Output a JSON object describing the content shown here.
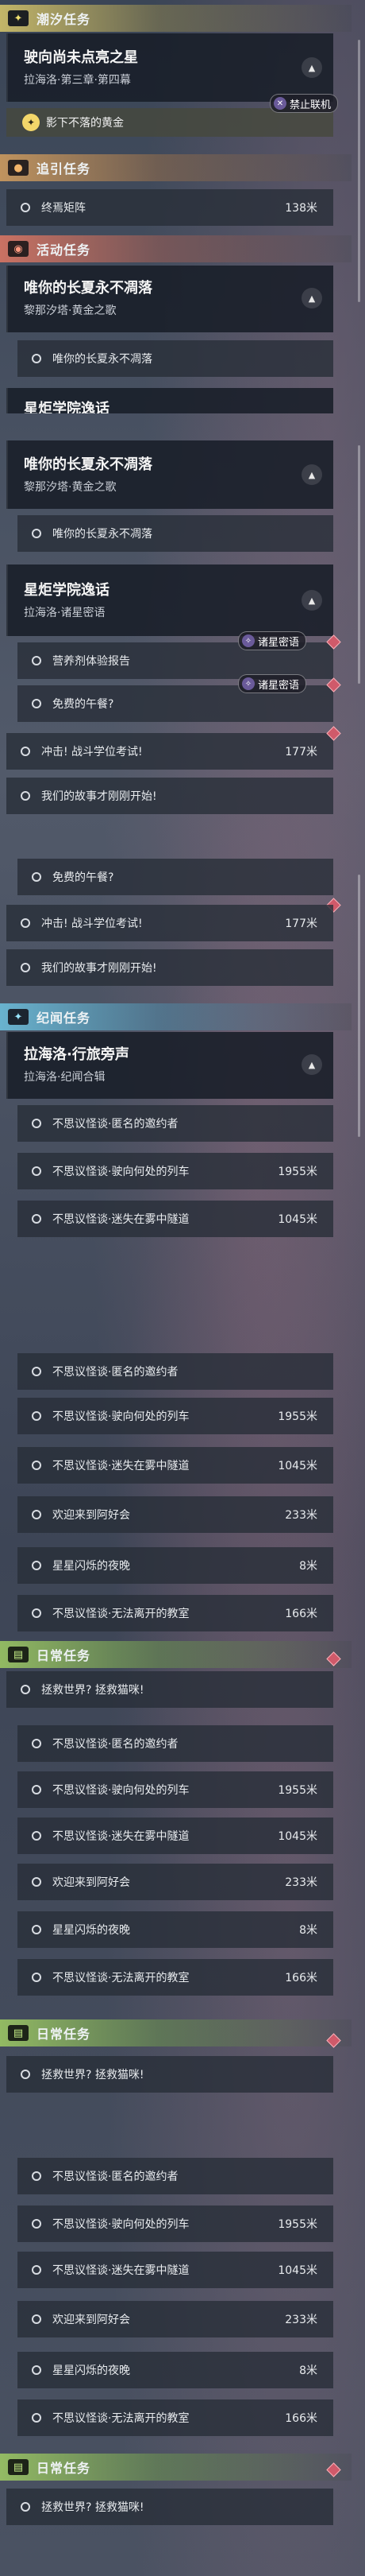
{
  "panel1": {
    "sec_chaoxi": "潮汐任务",
    "card1_title": "驶向尚未点亮之星",
    "card1_sub": "拉海洛·第三章·第四幕",
    "star_item": "影下不落的黄金",
    "tag_no_coop": "禁止联机",
    "sec_guide": "追引任务",
    "guide_item": "终焉矩阵",
    "guide_dist": "138米",
    "sec_event": "活动任务",
    "card2_title": "唯你的长夏永不凋落",
    "card2_sub": "黎那汐塔·黄金之歌",
    "event_item": "唯你的长夏永不凋落",
    "cut_title": "星炬学院逸话"
  },
  "panel2": {
    "card_title": "唯你的长夏永不凋落",
    "card_sub": "黎那汐塔·黄金之歌",
    "item1": "唯你的长夏永不凋落",
    "card2_title": "星炬学院逸话",
    "card2_sub": "拉海洛·诸星密语",
    "tag": "诸星密语",
    "rows": [
      {
        "label": "营养剂体验报告",
        "dist": ""
      },
      {
        "label": "免费的午餐?",
        "dist": ""
      },
      {
        "label": "冲击! 战斗学位考试!",
        "dist": "177米"
      },
      {
        "label": "我们的故事才刚刚开始!",
        "dist": ""
      }
    ]
  },
  "panel3": {
    "rows_top": [
      {
        "label": "免费的午餐?",
        "dist": ""
      },
      {
        "label": "冲击! 战斗学位考试!",
        "dist": "177米"
      },
      {
        "label": "我们的故事才刚刚开始!",
        "dist": ""
      }
    ],
    "sec_title": "纪闻任务",
    "card_title": "拉海洛·行旅旁声",
    "card_sub": "拉海洛·纪闻合辑",
    "rows": [
      {
        "label": "不思议怪谈·匿名的邀约者",
        "dist": ""
      },
      {
        "label": "不思议怪谈·驶向何处的列车",
        "dist": "1955米"
      },
      {
        "label": "不思议怪谈·迷失在雾中隧道",
        "dist": "1045米"
      }
    ]
  },
  "list": {
    "rows": [
      {
        "label": "不思议怪谈·匿名的邀约者",
        "dist": ""
      },
      {
        "label": "不思议怪谈·驶向何处的列车",
        "dist": "1955米"
      },
      {
        "label": "不思议怪谈·迷失在雾中隧道",
        "dist": "1045米"
      },
      {
        "label": "欢迎来到阿好会",
        "dist": "233米"
      },
      {
        "label": "星星闪烁的夜晚",
        "dist": "8米"
      },
      {
        "label": "不思议怪谈·无法离开的教室",
        "dist": "166米"
      }
    ],
    "sec_daily": "日常任务",
    "daily_item": "拯救世界? 拯救猫咪!"
  },
  "colors": {
    "accent_yellow": "#f3d66a",
    "diamond": "#d05a6a"
  }
}
